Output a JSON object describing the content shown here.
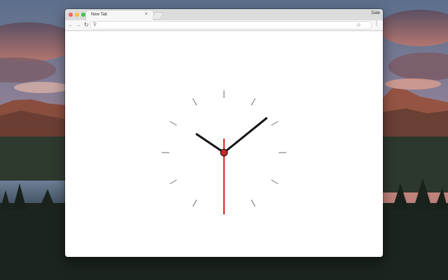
{
  "browser": {
    "tab": {
      "title": "New Tab",
      "close_glyph": "×"
    },
    "profile_name": "Dale",
    "toolbar": {
      "back_glyph": "←",
      "forward_glyph": "→",
      "reload_glyph": "↻",
      "search_glyph": "⚲",
      "star_glyph": "☆",
      "menu_glyph": "⋮",
      "omnibox_value": ""
    }
  },
  "clock": {
    "time": {
      "hours": 10,
      "minutes": 8,
      "seconds": 30
    },
    "colors": {
      "hands": "#111111",
      "second_hand": "#e0231b",
      "ticks": "#6a6a6a",
      "center": "#c62a22"
    }
  },
  "window_controls": {
    "close_color": "#fc605c",
    "minimize_color": "#fdbc40",
    "maximize_color": "#34c84a"
  }
}
